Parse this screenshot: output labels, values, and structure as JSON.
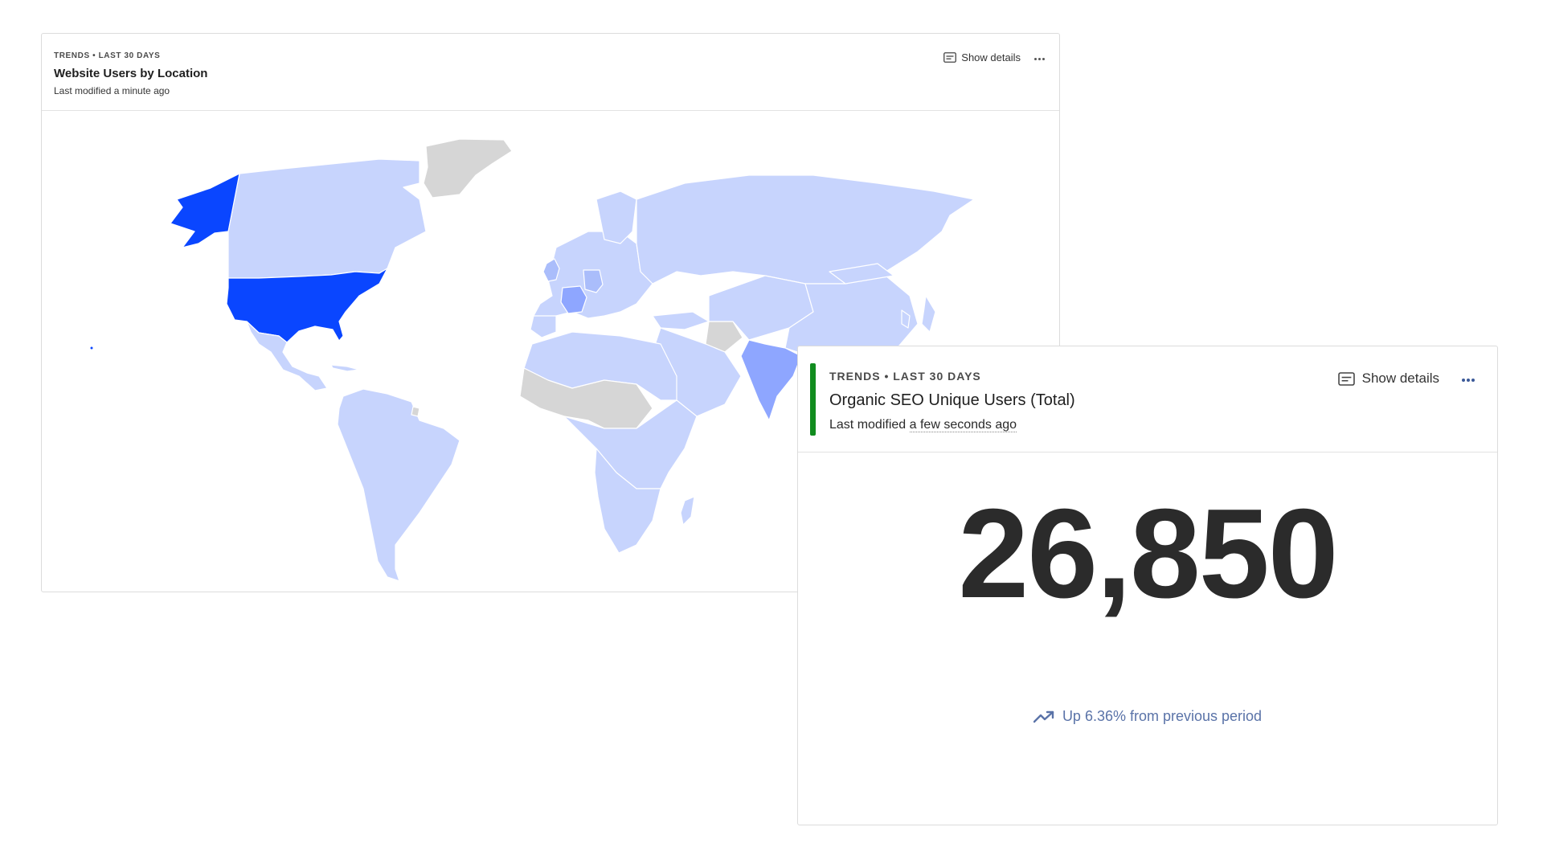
{
  "map_card": {
    "eyebrow": "TRENDS • LAST 30 DAYS",
    "title": "Website Users by Location",
    "modified": "Last modified a minute ago",
    "show_details_label": "Show details",
    "map_colors": {
      "highest": "#0a46ff",
      "high": "#8ea6ff",
      "medium": "#aabdfb",
      "low": "#c7d4fd",
      "no_data": "#d6d6d6"
    }
  },
  "kpi_card": {
    "eyebrow": "TRENDS • LAST 30 DAYS",
    "title": "Organic SEO Unique Users (Total)",
    "modified_prefix": "Last modified",
    "modified_time": "a few seconds ago",
    "show_details_label": "Show details",
    "value": "26,850",
    "delta_text": "Up 6.36% from previous period",
    "accent_color": "#118c1f",
    "delta_color": "#5a73a8"
  }
}
